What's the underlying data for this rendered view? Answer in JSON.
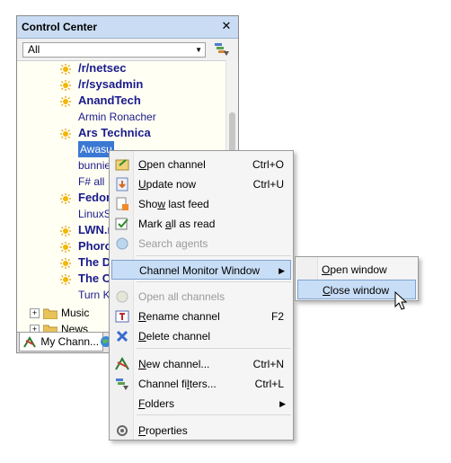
{
  "panel": {
    "title": "Control Center",
    "close_glyph": "✕",
    "filter": {
      "value": "All"
    }
  },
  "tree": {
    "feeds": [
      {
        "label": "/r/netsec",
        "bold": true,
        "icon": "sun-icon"
      },
      {
        "label": "/r/sysadmin",
        "bold": true,
        "icon": "sun-icon"
      },
      {
        "label": "AnandTech",
        "bold": true,
        "icon": "sun-icon"
      },
      {
        "label": "Armin Ronacher",
        "bold": false,
        "icon": ""
      },
      {
        "label": "Ars Technica",
        "bold": true,
        "icon": "sun-icon"
      },
      {
        "label": "Awasu",
        "bold": false,
        "icon": "",
        "selected": true
      },
      {
        "label": "bunnie",
        "bold": false,
        "icon": ""
      },
      {
        "label": "F# all",
        "bold": false,
        "icon": ""
      },
      {
        "label": "Fedor",
        "bold": true,
        "icon": "sun-icon"
      },
      {
        "label": "LinuxS",
        "bold": false,
        "icon": ""
      },
      {
        "label": "LWN.n",
        "bold": true,
        "icon": "sun-icon"
      },
      {
        "label": "Phoro",
        "bold": true,
        "icon": "sun-icon"
      },
      {
        "label": "The D",
        "bold": true,
        "icon": "sun-icon"
      },
      {
        "label": "The O",
        "bold": true,
        "icon": "sun-icon"
      },
      {
        "label": "Turn K",
        "bold": false,
        "icon": ""
      }
    ],
    "folders": [
      {
        "label": "Music",
        "expander": "+"
      },
      {
        "label": "News",
        "expander": "+"
      }
    ]
  },
  "tabs": [
    {
      "label": "My Chann..."
    }
  ],
  "menu": {
    "items": [
      {
        "id": "open-channel",
        "pre": "",
        "u": "O",
        "post": "pen channel",
        "shortcut": "Ctrl+O",
        "disabled": false
      },
      {
        "id": "update-now",
        "pre": "",
        "u": "U",
        "post": "pdate now",
        "shortcut": "Ctrl+U",
        "disabled": false
      },
      {
        "id": "show-last-feed",
        "pre": "Sho",
        "u": "w",
        "post": " last feed",
        "shortcut": "",
        "disabled": false
      },
      {
        "id": "mark-all-as-read",
        "pre": "Mark ",
        "u": "a",
        "post": "ll as read",
        "shortcut": "",
        "disabled": false
      },
      {
        "id": "search-agents",
        "pre": "Search a",
        "u": "g",
        "post": "ents",
        "shortcut": "",
        "disabled": true
      },
      {
        "id": "channel-monitor-window",
        "pre": "Channel Monitor Window",
        "u": "",
        "post": "",
        "shortcut": "",
        "disabled": false,
        "submenu": true
      },
      {
        "id": "open-all-channels",
        "pre": "Open all channels",
        "u": "",
        "post": "",
        "shortcut": "",
        "disabled": true
      },
      {
        "id": "rename-channel",
        "pre": "",
        "u": "R",
        "post": "ename channel",
        "shortcut": "F2",
        "disabled": false
      },
      {
        "id": "delete-channel",
        "pre": "",
        "u": "D",
        "post": "elete channel",
        "shortcut": "",
        "disabled": false
      },
      {
        "id": "new-channel",
        "pre": "",
        "u": "N",
        "post": "ew channel...",
        "shortcut": "Ctrl+N",
        "disabled": false
      },
      {
        "id": "channel-filters",
        "pre": "Channel fi",
        "u": "l",
        "post": "ters...",
        "shortcut": "Ctrl+L",
        "disabled": false
      },
      {
        "id": "folders",
        "pre": "",
        "u": "F",
        "post": "olders",
        "shortcut": "",
        "disabled": false,
        "submenu": true
      },
      {
        "id": "properties",
        "pre": "",
        "u": "P",
        "post": "roperties",
        "shortcut": "",
        "disabled": false
      }
    ],
    "submenu_arrow": "▶"
  },
  "submenu": {
    "items": [
      {
        "id": "open-window",
        "pre": "",
        "u": "O",
        "post": "pen window"
      },
      {
        "id": "close-window",
        "pre": "",
        "u": "C",
        "post": "lose window"
      }
    ]
  },
  "colors": {
    "title_bar": "#c9dcf3",
    "feed_text": "#1a1a8c",
    "selection": "#3a78d4",
    "menu_hover": "#c8ddf6"
  }
}
